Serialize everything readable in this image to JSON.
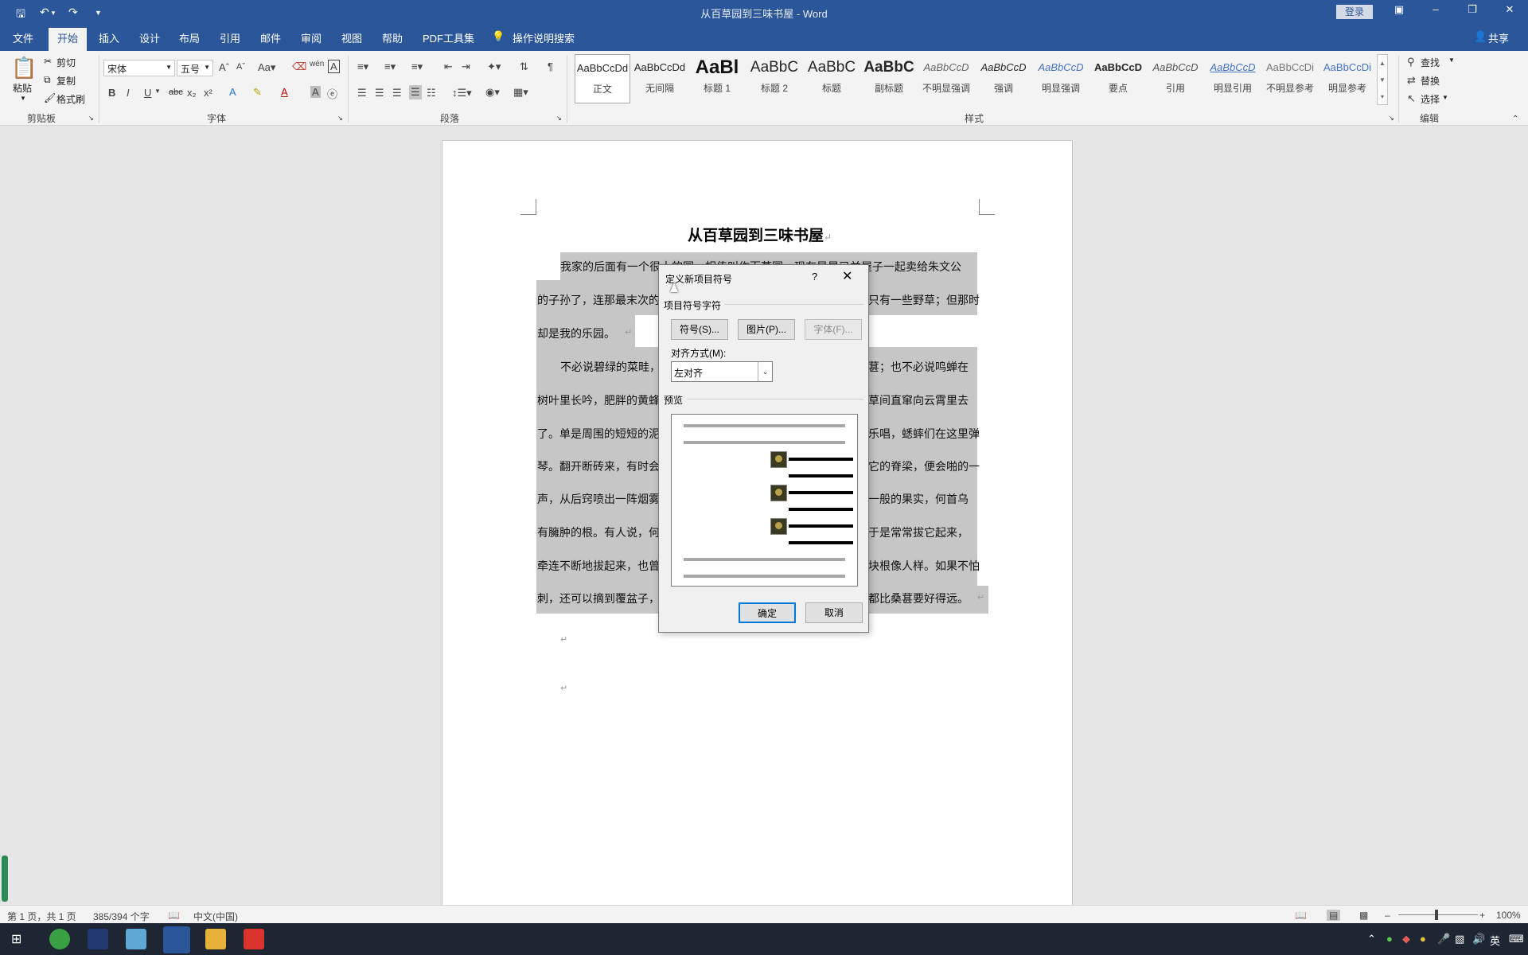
{
  "titlebar": {
    "title": "从百草园到三味书屋  -  Word",
    "login": "登录",
    "qa_save_icon": "save-icon",
    "qa_undo_icon": "undo-icon",
    "qa_redo_icon": "redo-icon"
  },
  "tabs": [
    "文件",
    "开始",
    "插入",
    "设计",
    "布局",
    "引用",
    "邮件",
    "审阅",
    "视图",
    "帮助",
    "PDF工具集"
  ],
  "tell_me": "操作说明搜索",
  "share": "共享",
  "clipboard": {
    "paste": "粘贴",
    "cut": "剪切",
    "copy": "复制",
    "format_painter": "格式刷",
    "label": "剪贴板"
  },
  "font": {
    "name": "宋体",
    "size": "五号",
    "label": "字体"
  },
  "paragraph": {
    "label": "段落"
  },
  "styles": {
    "label": "样式",
    "items": [
      {
        "preview": "AaBbCcDd",
        "name": "正文"
      },
      {
        "preview": "AaBbCcDd",
        "name": "无间隔"
      },
      {
        "preview": "AaBl",
        "name": "标题 1"
      },
      {
        "preview": "AaBbC",
        "name": "标题 2"
      },
      {
        "preview": "AaBbC",
        "name": "标题"
      },
      {
        "preview": "AaBbC",
        "name": "副标题"
      },
      {
        "preview": "AaBbCcD",
        "name": "不明显强调"
      },
      {
        "preview": "AaBbCcD",
        "name": "强调"
      },
      {
        "preview": "AaBbCcD",
        "name": "明显强调"
      },
      {
        "preview": "AaBbCcD",
        "name": "要点"
      },
      {
        "preview": "AaBbCcD",
        "name": "引用"
      },
      {
        "preview": "AaBbCcD",
        "name": "明显引用"
      },
      {
        "preview": "AaBbCcDi",
        "name": "不明显参考"
      },
      {
        "preview": "AaBbCcDi",
        "name": "明显参考"
      }
    ]
  },
  "editing": {
    "find": "查找",
    "replace": "替换",
    "select": "选择",
    "label": "编辑"
  },
  "document": {
    "title": "从百草园到三味书屋",
    "lines": [
      "我家的后面有一个很大的园，相传叫作百草园。现在是早已并屋子一起卖给朱文公",
      "的子孙了，连那最末次的",
      "只有一些野草；但那时",
      "却是我的乐园。",
      "不必说碧绿的菜畦，",
      "葚；也不必说鸣蝉在",
      "树叶里长吟，肥胖的黄蜂",
      "草间直窜向云霄里去",
      "了。单是周围的短短的泥",
      "乐唱，蟋蟀们在这里弹",
      "琴。翻开断砖来，有时会",
      "它的脊梁，便会啪的一",
      "声，从后窍喷出一阵烟雾",
      "一般的果实，何首乌",
      "有臃肿的根。有人说，何",
      "于是常常拔它起来，",
      "牵连不断地拔起来，也曾",
      "块根像人样。如果不怕",
      "刺，还可以摘到覆盆子，",
      "都比桑葚要好得远。"
    ]
  },
  "dialog": {
    "title": "定义新项目符号",
    "help": "?",
    "section_bullet": "项目符号字符",
    "btn_symbol": "符号(S)...",
    "btn_picture": "图片(P)...",
    "btn_font": "字体(F)...",
    "align_label": "对齐方式(M):",
    "align_value": "左对齐",
    "preview_label": "预览",
    "ok": "确定",
    "cancel": "取消"
  },
  "status": {
    "page": "第 1 页，共 1 页",
    "words": "385/394 个字",
    "lang": "中文(中国)",
    "zoom": "100%"
  },
  "tray": {
    "ime": "英",
    "time_icon": "clock-icon"
  },
  "colors": {
    "brand": "#2b579a",
    "highlight": "#c6c6c6",
    "taskbar": "#1e2633"
  }
}
